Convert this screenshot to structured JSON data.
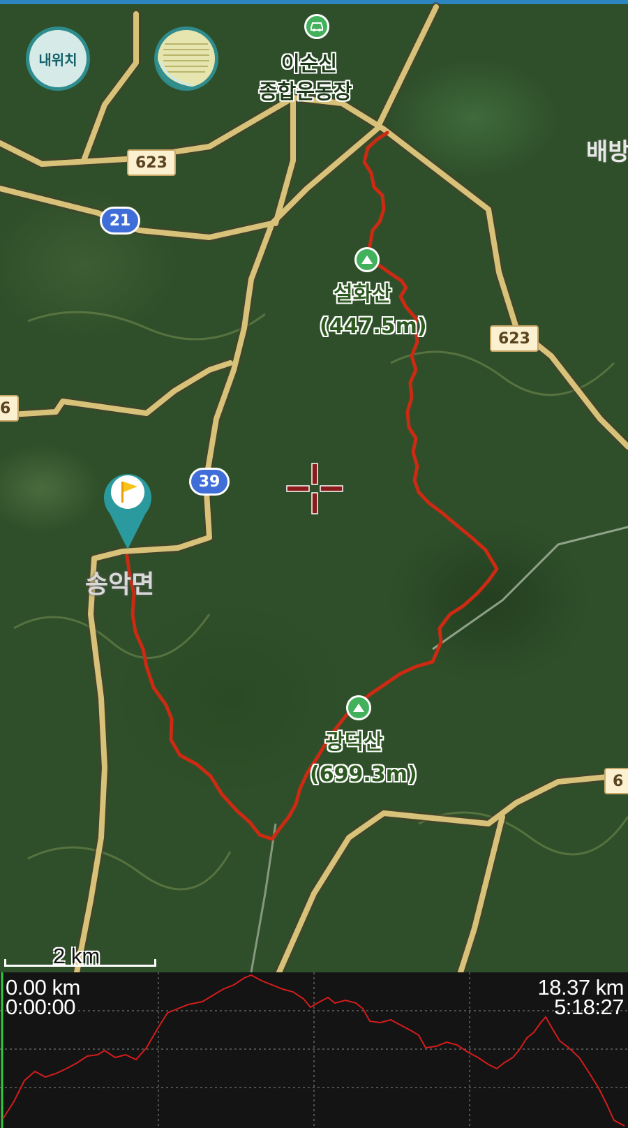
{
  "map": {
    "buttons": {
      "my_location_label": "내위치",
      "layer_icon": "layer-icon"
    },
    "place_labels": {
      "stadium_line1": "이순신",
      "stadium_line2": "종합운동장",
      "town": "송악면",
      "edge_label": "배방"
    },
    "peaks": [
      {
        "name": "설화산",
        "elevation": "(447.5m)"
      },
      {
        "name": "광덕산",
        "elevation": "(699.3m)"
      }
    ],
    "route_shields": [
      "21",
      "39"
    ],
    "road_badges": [
      "623",
      "623",
      "6",
      "6"
    ],
    "scale_label": "2 km",
    "colors": {
      "track": "#cc2a12",
      "road": "#d8c27a",
      "shield": "#3f6ed8",
      "poi": "#43b05b",
      "flag_pin": "#2a9a9e",
      "profile_line": "#d41c1c",
      "profile_bg": "#141414"
    }
  },
  "profile": {
    "start_distance": "0.00 km",
    "start_time": "0:00:00",
    "end_distance": "18.37 km",
    "end_time": "5:18:27"
  }
}
